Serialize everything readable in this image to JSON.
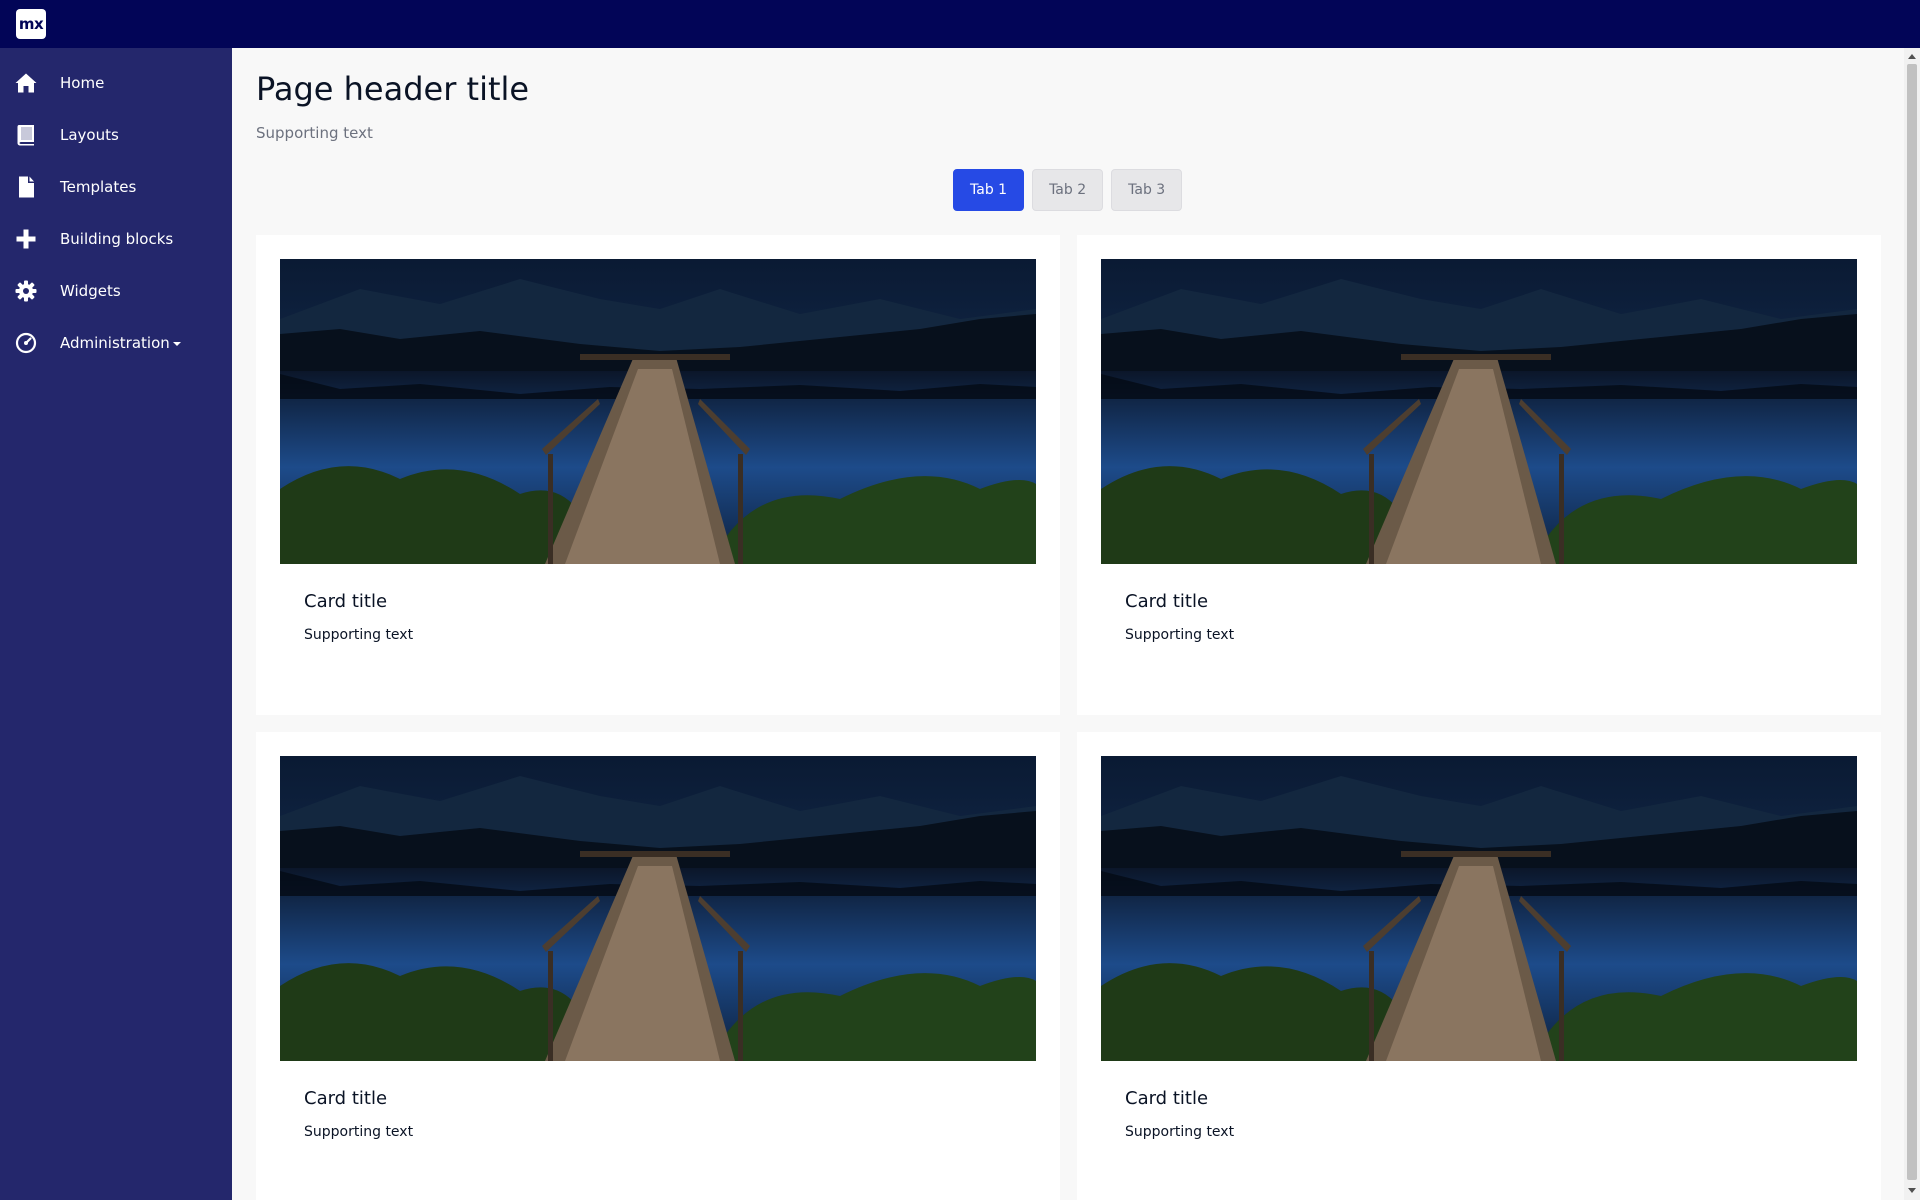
{
  "topbar": {
    "logo_text": "mx"
  },
  "sidebar": {
    "items": [
      {
        "label": "Home",
        "icon": "home-icon"
      },
      {
        "label": "Layouts",
        "icon": "book-icon"
      },
      {
        "label": "Templates",
        "icon": "file-icon"
      },
      {
        "label": "Building blocks",
        "icon": "plus-icon"
      },
      {
        "label": "Widgets",
        "icon": "gear-icon"
      },
      {
        "label": "Administration",
        "icon": "dashboard-icon",
        "has_dropdown": true
      }
    ]
  },
  "header": {
    "title": "Page header title",
    "subtitle": "Supporting text"
  },
  "tabs": [
    {
      "label": "Tab 1",
      "active": true
    },
    {
      "label": "Tab 2",
      "active": false
    },
    {
      "label": "Tab 3",
      "active": false
    }
  ],
  "cards": [
    {
      "title": "Card title",
      "text": "Supporting text",
      "image": "lake-dock-image"
    },
    {
      "title": "Card title",
      "text": "Supporting text",
      "image": "lake-dock-image"
    },
    {
      "title": "Card title",
      "text": "Supporting text",
      "image": "lake-dock-image"
    },
    {
      "title": "Card title",
      "text": "Supporting text",
      "image": "lake-dock-image"
    }
  ],
  "colors": {
    "topbar": "#020557",
    "sidebar": "#24276c",
    "accent": "#264ae5",
    "background": "#f8f8f8"
  }
}
